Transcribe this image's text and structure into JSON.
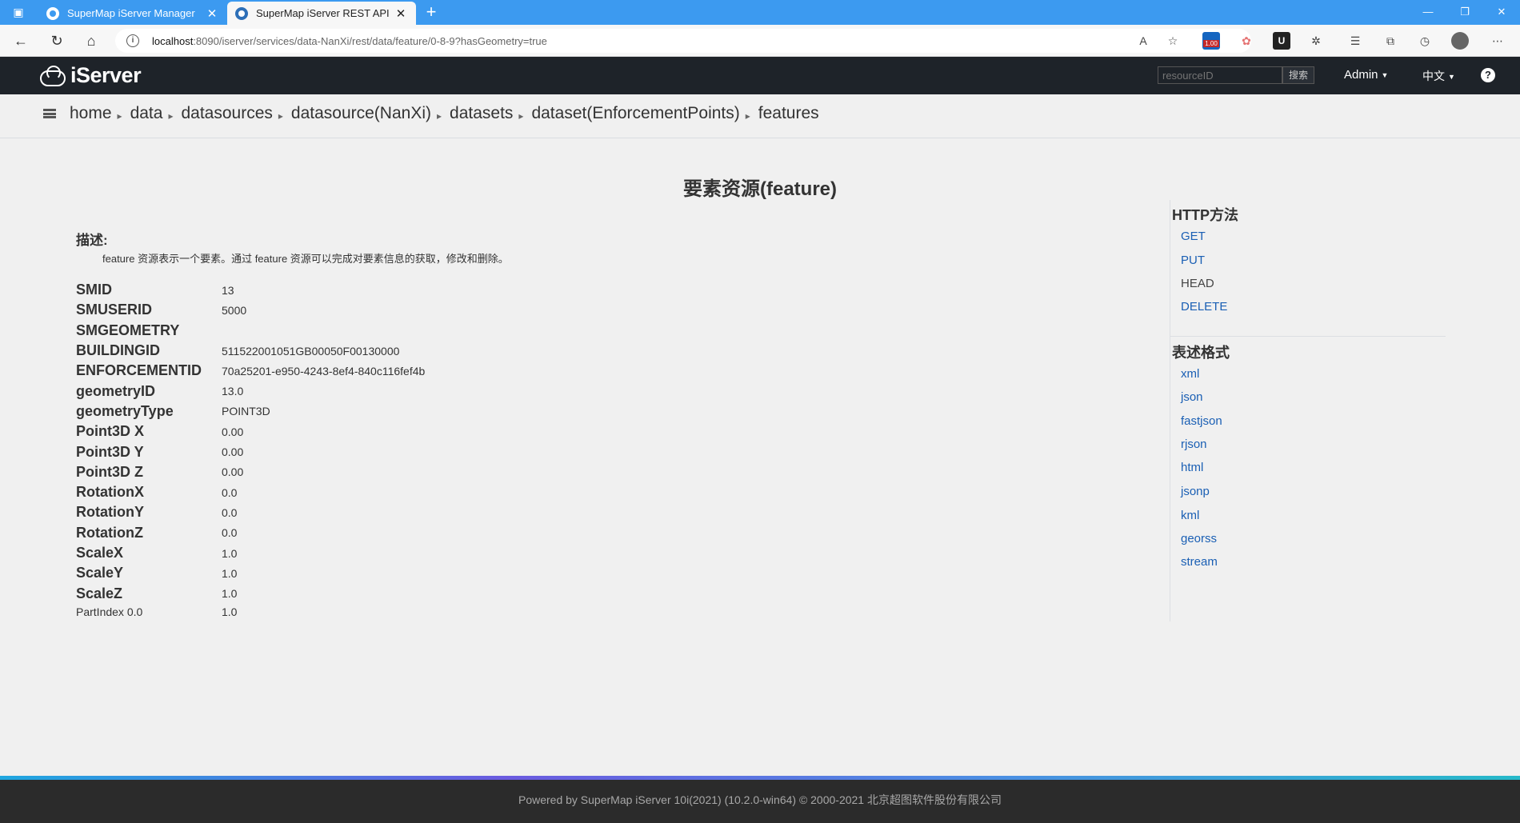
{
  "browser": {
    "tabs": [
      {
        "title": "SuperMap iServer Manager",
        "active": false
      },
      {
        "title": "SuperMap iServer REST API",
        "active": true
      }
    ],
    "url_host": "localhost",
    "url_rest": ":8090/iserver/services/data-NanXi/rest/data/feature/0-8-9?hasGeometry=true",
    "extension_badge": "1.00"
  },
  "header": {
    "brand": "iServer",
    "search_placeholder": "resourceID",
    "search_button": "搜索",
    "user_menu": "Admin",
    "language_menu": "中文"
  },
  "breadcrumb": [
    "home",
    "data",
    "datasources",
    "datasource(NanXi)",
    "datasets",
    "dataset(EnforcementPoints)",
    "features"
  ],
  "page": {
    "title": "要素资源(feature)",
    "description_label": "描述:",
    "description": "feature 资源表示一个要素。通过 feature 资源可以完成对要素信息的获取，修改和删除。"
  },
  "fields": [
    {
      "name": "SMID",
      "value": "13"
    },
    {
      "name": "SMUSERID",
      "value": "5000"
    },
    {
      "name": "SMGEOMETRY",
      "value": ""
    },
    {
      "name": "BUILDINGID",
      "value": "511522001051GB00050F00130000"
    },
    {
      "name": "ENFORCEMENTID",
      "value": "70a25201-e950-4243-8ef4-840c116fef4b"
    },
    {
      "name": "geometryID",
      "value": "13.0"
    },
    {
      "name": "geometryType",
      "value": "POINT3D"
    },
    {
      "name": "Point3D X",
      "value": "0.00"
    },
    {
      "name": "Point3D Y",
      "value": "0.00"
    },
    {
      "name": "Point3D Z",
      "value": "0.00"
    },
    {
      "name": "RotationX",
      "value": "0.0"
    },
    {
      "name": "RotationY",
      "value": "0.0"
    },
    {
      "name": "RotationZ",
      "value": "0.0"
    },
    {
      "name": "ScaleX",
      "value": "1.0"
    },
    {
      "name": "ScaleY",
      "value": "1.0"
    },
    {
      "name": "ScaleZ",
      "value": "1.0"
    },
    {
      "name": "PartIndex 0.0",
      "value": "1.0"
    }
  ],
  "sidebar": {
    "http_methods_title": "HTTP方法",
    "http_methods": [
      {
        "label": "GET",
        "link": true
      },
      {
        "label": "PUT",
        "link": true
      },
      {
        "label": "HEAD",
        "link": false
      },
      {
        "label": "DELETE",
        "link": true
      }
    ],
    "formats_title": "表述格式",
    "formats": [
      "xml",
      "json",
      "fastjson",
      "rjson",
      "html",
      "jsonp",
      "kml",
      "georss",
      "stream"
    ]
  },
  "footer": {
    "text": "Powered by SuperMap iServer 10i(2021) (10.2.0-win64) © 2000-2021 北京超图软件股份有限公司"
  },
  "colors": {
    "tabstrip": "#3c9af0",
    "app_header": "#1e2329",
    "link": "#1a5fb4",
    "footer": "#2b2b2b"
  }
}
